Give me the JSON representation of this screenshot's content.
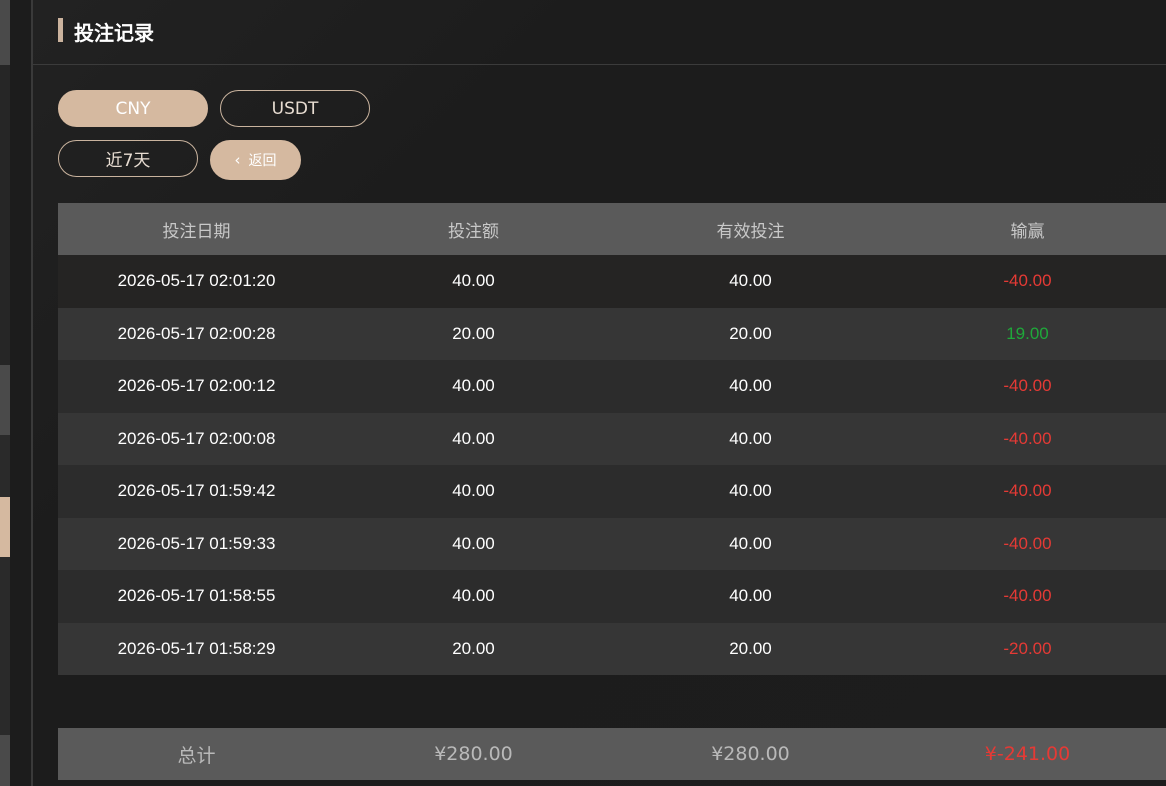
{
  "header": {
    "title": "投注记录"
  },
  "currency_tabs": [
    {
      "label": "CNY",
      "active": true
    },
    {
      "label": "USDT",
      "active": false
    }
  ],
  "filters": {
    "range_label": "近7天",
    "back_label": "返回"
  },
  "table": {
    "columns": [
      "投注日期",
      "投注额",
      "有效投注",
      "输赢"
    ],
    "rows": [
      {
        "date": "2026-05-17 02:01:20",
        "bet": "40.00",
        "valid": "40.00",
        "win": "-40.00"
      },
      {
        "date": "2026-05-17 02:00:28",
        "bet": "20.00",
        "valid": "20.00",
        "win": "19.00"
      },
      {
        "date": "2026-05-17 02:00:12",
        "bet": "40.00",
        "valid": "40.00",
        "win": "-40.00"
      },
      {
        "date": "2026-05-17 02:00:08",
        "bet": "40.00",
        "valid": "40.00",
        "win": "-40.00"
      },
      {
        "date": "2026-05-17 01:59:42",
        "bet": "40.00",
        "valid": "40.00",
        "win": "-40.00"
      },
      {
        "date": "2026-05-17 01:59:33",
        "bet": "40.00",
        "valid": "40.00",
        "win": "-40.00"
      },
      {
        "date": "2026-05-17 01:58:55",
        "bet": "40.00",
        "valid": "40.00",
        "win": "-40.00"
      },
      {
        "date": "2026-05-17 01:58:29",
        "bet": "20.00",
        "valid": "20.00",
        "win": "-20.00"
      }
    ]
  },
  "total": {
    "label": "总计",
    "bet": "¥280.00",
    "valid": "¥280.00",
    "win": "¥-241.00"
  },
  "colors": {
    "accent": "#d5b9a0",
    "negative": "#e53a35",
    "positive": "#1fa83a"
  }
}
